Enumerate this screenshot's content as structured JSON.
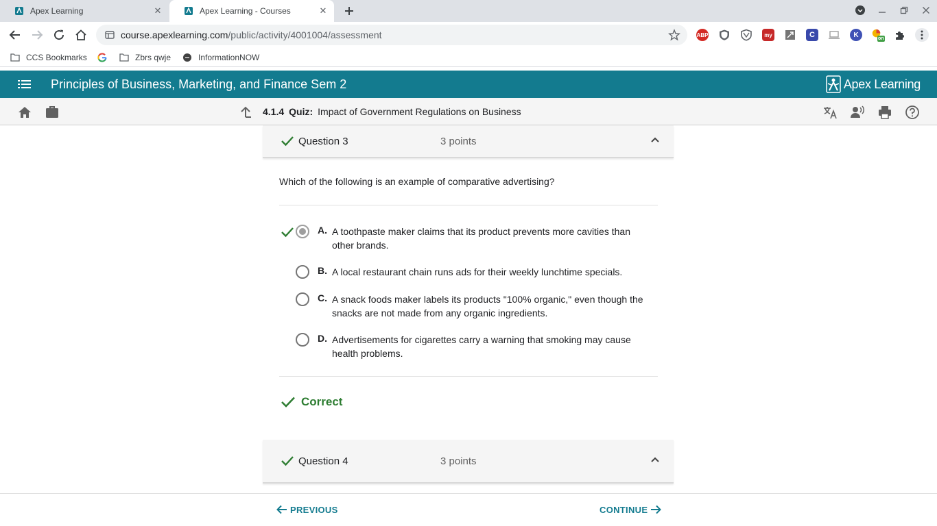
{
  "browser": {
    "tabs": [
      {
        "title": "Apex Learning",
        "active": false
      },
      {
        "title": "Apex Learning - Courses",
        "active": true
      }
    ],
    "url_host": "course.apexlearning.com",
    "url_path": "/public/activity/4001004/assessment",
    "bookmarks": [
      {
        "label": "CCS Bookmarks",
        "icon": "folder-icon"
      },
      {
        "label": "",
        "icon": "google-icon"
      },
      {
        "label": "Zbrs qwje",
        "icon": "folder-icon"
      },
      {
        "label": "InformationNOW",
        "icon": "site-icon"
      }
    ],
    "extensions": [
      {
        "name": "abp-extension-icon",
        "label": "ABP",
        "color": "#d42b25"
      },
      {
        "name": "shield-extension-icon",
        "label": "",
        "color": "#5f6368"
      },
      {
        "name": "shield-outline-extension-icon",
        "label": "",
        "color": "#5f6368"
      },
      {
        "name": "my-extension-icon",
        "label": "my",
        "color": "#c62828"
      },
      {
        "name": "screenshot-extension-icon",
        "label": "",
        "color": "#5f6368"
      },
      {
        "name": "c-extension-icon",
        "label": "C",
        "color": "#3949ab"
      },
      {
        "name": "laptop-extension-icon",
        "label": "",
        "color": "#9e9e9e"
      },
      {
        "name": "k-extension-icon",
        "label": "K",
        "color": "#3f51b5"
      },
      {
        "name": "on-extension-icon",
        "label": "on",
        "color": "#43a047"
      }
    ]
  },
  "app": {
    "course_title": "Principles of Business, Marketing, and Finance Sem 2",
    "logo_text": "Apex Learning",
    "activity_number": "4.1.4",
    "activity_type": "Quiz:",
    "activity_title": "Impact of Government Regulations on Business",
    "accent_color": "#137b8f"
  },
  "question3": {
    "label": "Question 3",
    "points": "3 points",
    "prompt": "Which of the following is an example of comparative advertising?",
    "choices": [
      {
        "letter": "A.",
        "text": "A toothpaste maker claims that its product prevents more cavities than other brands.",
        "selected": true,
        "correct_mark": true
      },
      {
        "letter": "B.",
        "text": "A local restaurant chain runs ads for their weekly lunchtime specials.",
        "selected": false,
        "correct_mark": false
      },
      {
        "letter": "C.",
        "text": "A snack foods maker labels its products \"100% organic,\" even though the snacks are not made from any organic ingredients.",
        "selected": false,
        "correct_mark": false
      },
      {
        "letter": "D.",
        "text": "Advertisements for cigarettes carry a warning that smoking may cause health problems.",
        "selected": false,
        "correct_mark": false
      }
    ],
    "result": "Correct"
  },
  "question4": {
    "label": "Question 4",
    "points": "3 points"
  },
  "footer": {
    "previous_label": "PREVIOUS",
    "continue_label": "CONTINUE"
  }
}
